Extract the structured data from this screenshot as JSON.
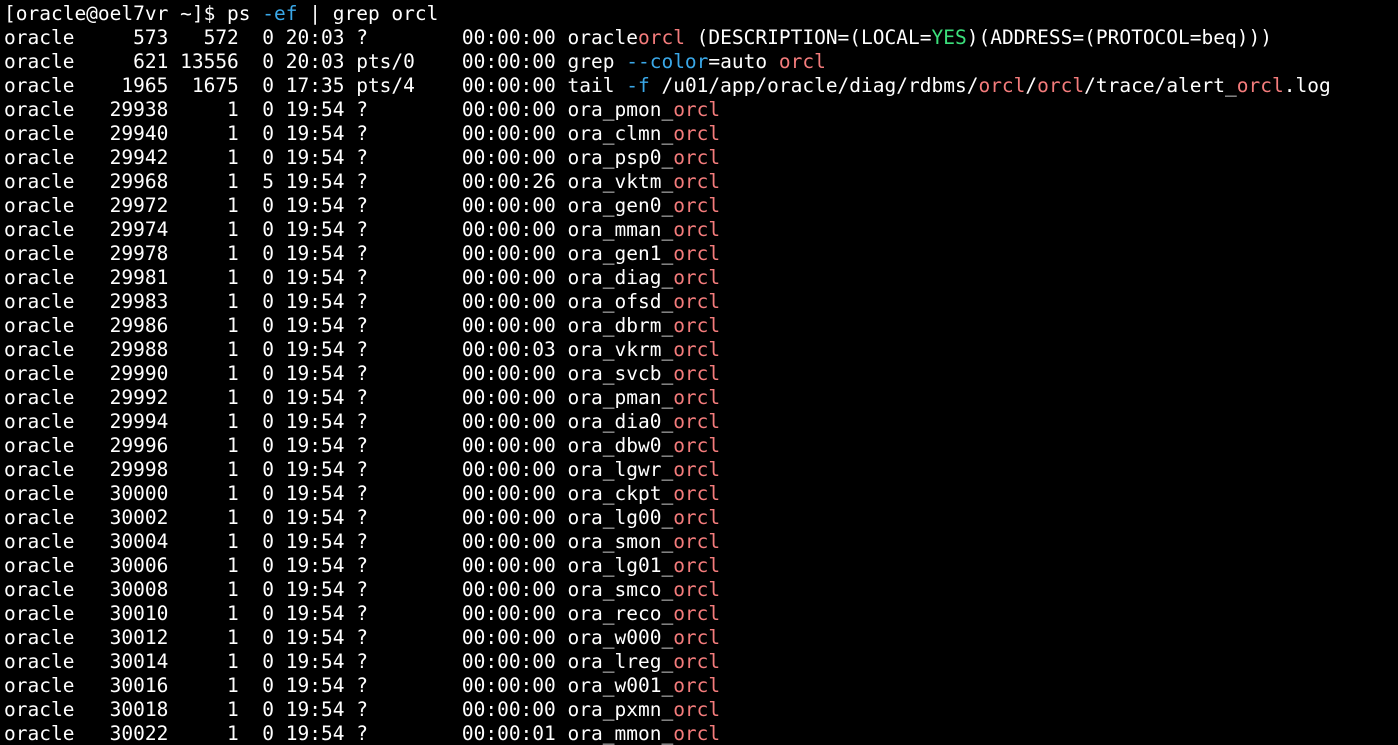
{
  "window": {
    "background": "#000000",
    "foreground": "#ffffff"
  },
  "colors": {
    "fg": "#ffffff",
    "red": "#f47c7c",
    "cyan": "#3aa8e8",
    "green": "#3ce07c"
  },
  "terminal": {
    "lines": [
      [
        {
          "t": "[oracle@oel7vr ~]$ ps ",
          "c": "fg"
        },
        {
          "t": "-ef",
          "c": "cyan"
        },
        {
          "t": " | grep orcl",
          "c": "fg"
        }
      ],
      [
        {
          "t": "oracle     573   572  0 20:03 ?        00:00:00 oracle",
          "c": "fg"
        },
        {
          "t": "orcl",
          "c": "red"
        },
        {
          "t": " (DESCRIPTION=(LOCAL=",
          "c": "fg"
        },
        {
          "t": "YES",
          "c": "green"
        },
        {
          "t": ")(ADDRESS=(PROTOCOL=beq)))",
          "c": "fg"
        }
      ],
      [
        {
          "t": "oracle     621 13556  0 20:03 pts/0    00:00:00 grep ",
          "c": "fg"
        },
        {
          "t": "--color",
          "c": "cyan"
        },
        {
          "t": "=auto ",
          "c": "fg"
        },
        {
          "t": "orcl",
          "c": "red"
        }
      ],
      [
        {
          "t": "oracle    1965  1675  0 17:35 pts/4    00:00:00 tail ",
          "c": "fg"
        },
        {
          "t": "-f",
          "c": "cyan"
        },
        {
          "t": " /u01/app/oracle/diag/rdbms/",
          "c": "fg"
        },
        {
          "t": "orcl",
          "c": "red"
        },
        {
          "t": "/",
          "c": "fg"
        },
        {
          "t": "orcl",
          "c": "red"
        },
        {
          "t": "/trace/alert_",
          "c": "fg"
        },
        {
          "t": "orcl",
          "c": "red"
        },
        {
          "t": ".log",
          "c": "fg"
        }
      ],
      [
        {
          "t": "oracle   29938     1  0 19:54 ?        00:00:00 ora_pmon_",
          "c": "fg"
        },
        {
          "t": "orcl",
          "c": "red"
        }
      ],
      [
        {
          "t": "oracle   29940     1  0 19:54 ?        00:00:00 ora_clmn_",
          "c": "fg"
        },
        {
          "t": "orcl",
          "c": "red"
        }
      ],
      [
        {
          "t": "oracle   29942     1  0 19:54 ?        00:00:00 ora_psp0_",
          "c": "fg"
        },
        {
          "t": "orcl",
          "c": "red"
        }
      ],
      [
        {
          "t": "oracle   29968     1  5 19:54 ?        00:00:26 ora_vktm_",
          "c": "fg"
        },
        {
          "t": "orcl",
          "c": "red"
        }
      ],
      [
        {
          "t": "oracle   29972     1  0 19:54 ?        00:00:00 ora_gen0_",
          "c": "fg"
        },
        {
          "t": "orcl",
          "c": "red"
        }
      ],
      [
        {
          "t": "oracle   29974     1  0 19:54 ?        00:00:00 ora_mman_",
          "c": "fg"
        },
        {
          "t": "orcl",
          "c": "red"
        }
      ],
      [
        {
          "t": "oracle   29978     1  0 19:54 ?        00:00:00 ora_gen1_",
          "c": "fg"
        },
        {
          "t": "orcl",
          "c": "red"
        }
      ],
      [
        {
          "t": "oracle   29981     1  0 19:54 ?        00:00:00 ora_diag_",
          "c": "fg"
        },
        {
          "t": "orcl",
          "c": "red"
        }
      ],
      [
        {
          "t": "oracle   29983     1  0 19:54 ?        00:00:00 ora_ofsd_",
          "c": "fg"
        },
        {
          "t": "orcl",
          "c": "red"
        }
      ],
      [
        {
          "t": "oracle   29986     1  0 19:54 ?        00:00:00 ora_dbrm_",
          "c": "fg"
        },
        {
          "t": "orcl",
          "c": "red"
        }
      ],
      [
        {
          "t": "oracle   29988     1  0 19:54 ?        00:00:03 ora_vkrm_",
          "c": "fg"
        },
        {
          "t": "orcl",
          "c": "red"
        }
      ],
      [
        {
          "t": "oracle   29990     1  0 19:54 ?        00:00:00 ora_svcb_",
          "c": "fg"
        },
        {
          "t": "orcl",
          "c": "red"
        }
      ],
      [
        {
          "t": "oracle   29992     1  0 19:54 ?        00:00:00 ora_pman_",
          "c": "fg"
        },
        {
          "t": "orcl",
          "c": "red"
        }
      ],
      [
        {
          "t": "oracle   29994     1  0 19:54 ?        00:00:00 ora_dia0_",
          "c": "fg"
        },
        {
          "t": "orcl",
          "c": "red"
        }
      ],
      [
        {
          "t": "oracle   29996     1  0 19:54 ?        00:00:00 ora_dbw0_",
          "c": "fg"
        },
        {
          "t": "orcl",
          "c": "red"
        }
      ],
      [
        {
          "t": "oracle   29998     1  0 19:54 ?        00:00:00 ora_lgwr_",
          "c": "fg"
        },
        {
          "t": "orcl",
          "c": "red"
        }
      ],
      [
        {
          "t": "oracle   30000     1  0 19:54 ?        00:00:00 ora_ckpt_",
          "c": "fg"
        },
        {
          "t": "orcl",
          "c": "red"
        }
      ],
      [
        {
          "t": "oracle   30002     1  0 19:54 ?        00:00:00 ora_lg00_",
          "c": "fg"
        },
        {
          "t": "orcl",
          "c": "red"
        }
      ],
      [
        {
          "t": "oracle   30004     1  0 19:54 ?        00:00:00 ora_smon_",
          "c": "fg"
        },
        {
          "t": "orcl",
          "c": "red"
        }
      ],
      [
        {
          "t": "oracle   30006     1  0 19:54 ?        00:00:00 ora_lg01_",
          "c": "fg"
        },
        {
          "t": "orcl",
          "c": "red"
        }
      ],
      [
        {
          "t": "oracle   30008     1  0 19:54 ?        00:00:00 ora_smco_",
          "c": "fg"
        },
        {
          "t": "orcl",
          "c": "red"
        }
      ],
      [
        {
          "t": "oracle   30010     1  0 19:54 ?        00:00:00 ora_reco_",
          "c": "fg"
        },
        {
          "t": "orcl",
          "c": "red"
        }
      ],
      [
        {
          "t": "oracle   30012     1  0 19:54 ?        00:00:00 ora_w000_",
          "c": "fg"
        },
        {
          "t": "orcl",
          "c": "red"
        }
      ],
      [
        {
          "t": "oracle   30014     1  0 19:54 ?        00:00:00 ora_lreg_",
          "c": "fg"
        },
        {
          "t": "orcl",
          "c": "red"
        }
      ],
      [
        {
          "t": "oracle   30016     1  0 19:54 ?        00:00:00 ora_w001_",
          "c": "fg"
        },
        {
          "t": "orcl",
          "c": "red"
        }
      ],
      [
        {
          "t": "oracle   30018     1  0 19:54 ?        00:00:00 ora_pxmn_",
          "c": "fg"
        },
        {
          "t": "orcl",
          "c": "red"
        }
      ],
      [
        {
          "t": "oracle   30022     1  0 19:54 ?        00:00:01 ora_mmon_",
          "c": "fg"
        },
        {
          "t": "orcl",
          "c": "red"
        }
      ]
    ]
  }
}
